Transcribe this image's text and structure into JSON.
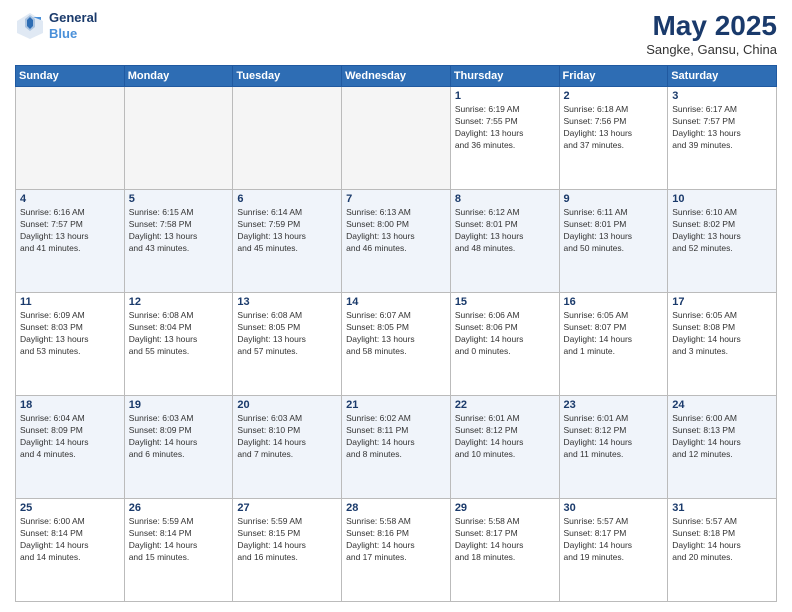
{
  "header": {
    "logo_line1": "General",
    "logo_line2": "Blue",
    "month": "May 2025",
    "location": "Sangke, Gansu, China"
  },
  "weekdays": [
    "Sunday",
    "Monday",
    "Tuesday",
    "Wednesday",
    "Thursday",
    "Friday",
    "Saturday"
  ],
  "weeks": [
    [
      {
        "day": "",
        "info": ""
      },
      {
        "day": "",
        "info": ""
      },
      {
        "day": "",
        "info": ""
      },
      {
        "day": "",
        "info": ""
      },
      {
        "day": "1",
        "info": "Sunrise: 6:19 AM\nSunset: 7:55 PM\nDaylight: 13 hours\nand 36 minutes."
      },
      {
        "day": "2",
        "info": "Sunrise: 6:18 AM\nSunset: 7:56 PM\nDaylight: 13 hours\nand 37 minutes."
      },
      {
        "day": "3",
        "info": "Sunrise: 6:17 AM\nSunset: 7:57 PM\nDaylight: 13 hours\nand 39 minutes."
      }
    ],
    [
      {
        "day": "4",
        "info": "Sunrise: 6:16 AM\nSunset: 7:57 PM\nDaylight: 13 hours\nand 41 minutes."
      },
      {
        "day": "5",
        "info": "Sunrise: 6:15 AM\nSunset: 7:58 PM\nDaylight: 13 hours\nand 43 minutes."
      },
      {
        "day": "6",
        "info": "Sunrise: 6:14 AM\nSunset: 7:59 PM\nDaylight: 13 hours\nand 45 minutes."
      },
      {
        "day": "7",
        "info": "Sunrise: 6:13 AM\nSunset: 8:00 PM\nDaylight: 13 hours\nand 46 minutes."
      },
      {
        "day": "8",
        "info": "Sunrise: 6:12 AM\nSunset: 8:01 PM\nDaylight: 13 hours\nand 48 minutes."
      },
      {
        "day": "9",
        "info": "Sunrise: 6:11 AM\nSunset: 8:01 PM\nDaylight: 13 hours\nand 50 minutes."
      },
      {
        "day": "10",
        "info": "Sunrise: 6:10 AM\nSunset: 8:02 PM\nDaylight: 13 hours\nand 52 minutes."
      }
    ],
    [
      {
        "day": "11",
        "info": "Sunrise: 6:09 AM\nSunset: 8:03 PM\nDaylight: 13 hours\nand 53 minutes."
      },
      {
        "day": "12",
        "info": "Sunrise: 6:08 AM\nSunset: 8:04 PM\nDaylight: 13 hours\nand 55 minutes."
      },
      {
        "day": "13",
        "info": "Sunrise: 6:08 AM\nSunset: 8:05 PM\nDaylight: 13 hours\nand 57 minutes."
      },
      {
        "day": "14",
        "info": "Sunrise: 6:07 AM\nSunset: 8:05 PM\nDaylight: 13 hours\nand 58 minutes."
      },
      {
        "day": "15",
        "info": "Sunrise: 6:06 AM\nSunset: 8:06 PM\nDaylight: 14 hours\nand 0 minutes."
      },
      {
        "day": "16",
        "info": "Sunrise: 6:05 AM\nSunset: 8:07 PM\nDaylight: 14 hours\nand 1 minute."
      },
      {
        "day": "17",
        "info": "Sunrise: 6:05 AM\nSunset: 8:08 PM\nDaylight: 14 hours\nand 3 minutes."
      }
    ],
    [
      {
        "day": "18",
        "info": "Sunrise: 6:04 AM\nSunset: 8:09 PM\nDaylight: 14 hours\nand 4 minutes."
      },
      {
        "day": "19",
        "info": "Sunrise: 6:03 AM\nSunset: 8:09 PM\nDaylight: 14 hours\nand 6 minutes."
      },
      {
        "day": "20",
        "info": "Sunrise: 6:03 AM\nSunset: 8:10 PM\nDaylight: 14 hours\nand 7 minutes."
      },
      {
        "day": "21",
        "info": "Sunrise: 6:02 AM\nSunset: 8:11 PM\nDaylight: 14 hours\nand 8 minutes."
      },
      {
        "day": "22",
        "info": "Sunrise: 6:01 AM\nSunset: 8:12 PM\nDaylight: 14 hours\nand 10 minutes."
      },
      {
        "day": "23",
        "info": "Sunrise: 6:01 AM\nSunset: 8:12 PM\nDaylight: 14 hours\nand 11 minutes."
      },
      {
        "day": "24",
        "info": "Sunrise: 6:00 AM\nSunset: 8:13 PM\nDaylight: 14 hours\nand 12 minutes."
      }
    ],
    [
      {
        "day": "25",
        "info": "Sunrise: 6:00 AM\nSunset: 8:14 PM\nDaylight: 14 hours\nand 14 minutes."
      },
      {
        "day": "26",
        "info": "Sunrise: 5:59 AM\nSunset: 8:14 PM\nDaylight: 14 hours\nand 15 minutes."
      },
      {
        "day": "27",
        "info": "Sunrise: 5:59 AM\nSunset: 8:15 PM\nDaylight: 14 hours\nand 16 minutes."
      },
      {
        "day": "28",
        "info": "Sunrise: 5:58 AM\nSunset: 8:16 PM\nDaylight: 14 hours\nand 17 minutes."
      },
      {
        "day": "29",
        "info": "Sunrise: 5:58 AM\nSunset: 8:17 PM\nDaylight: 14 hours\nand 18 minutes."
      },
      {
        "day": "30",
        "info": "Sunrise: 5:57 AM\nSunset: 8:17 PM\nDaylight: 14 hours\nand 19 minutes."
      },
      {
        "day": "31",
        "info": "Sunrise: 5:57 AM\nSunset: 8:18 PM\nDaylight: 14 hours\nand 20 minutes."
      }
    ]
  ]
}
